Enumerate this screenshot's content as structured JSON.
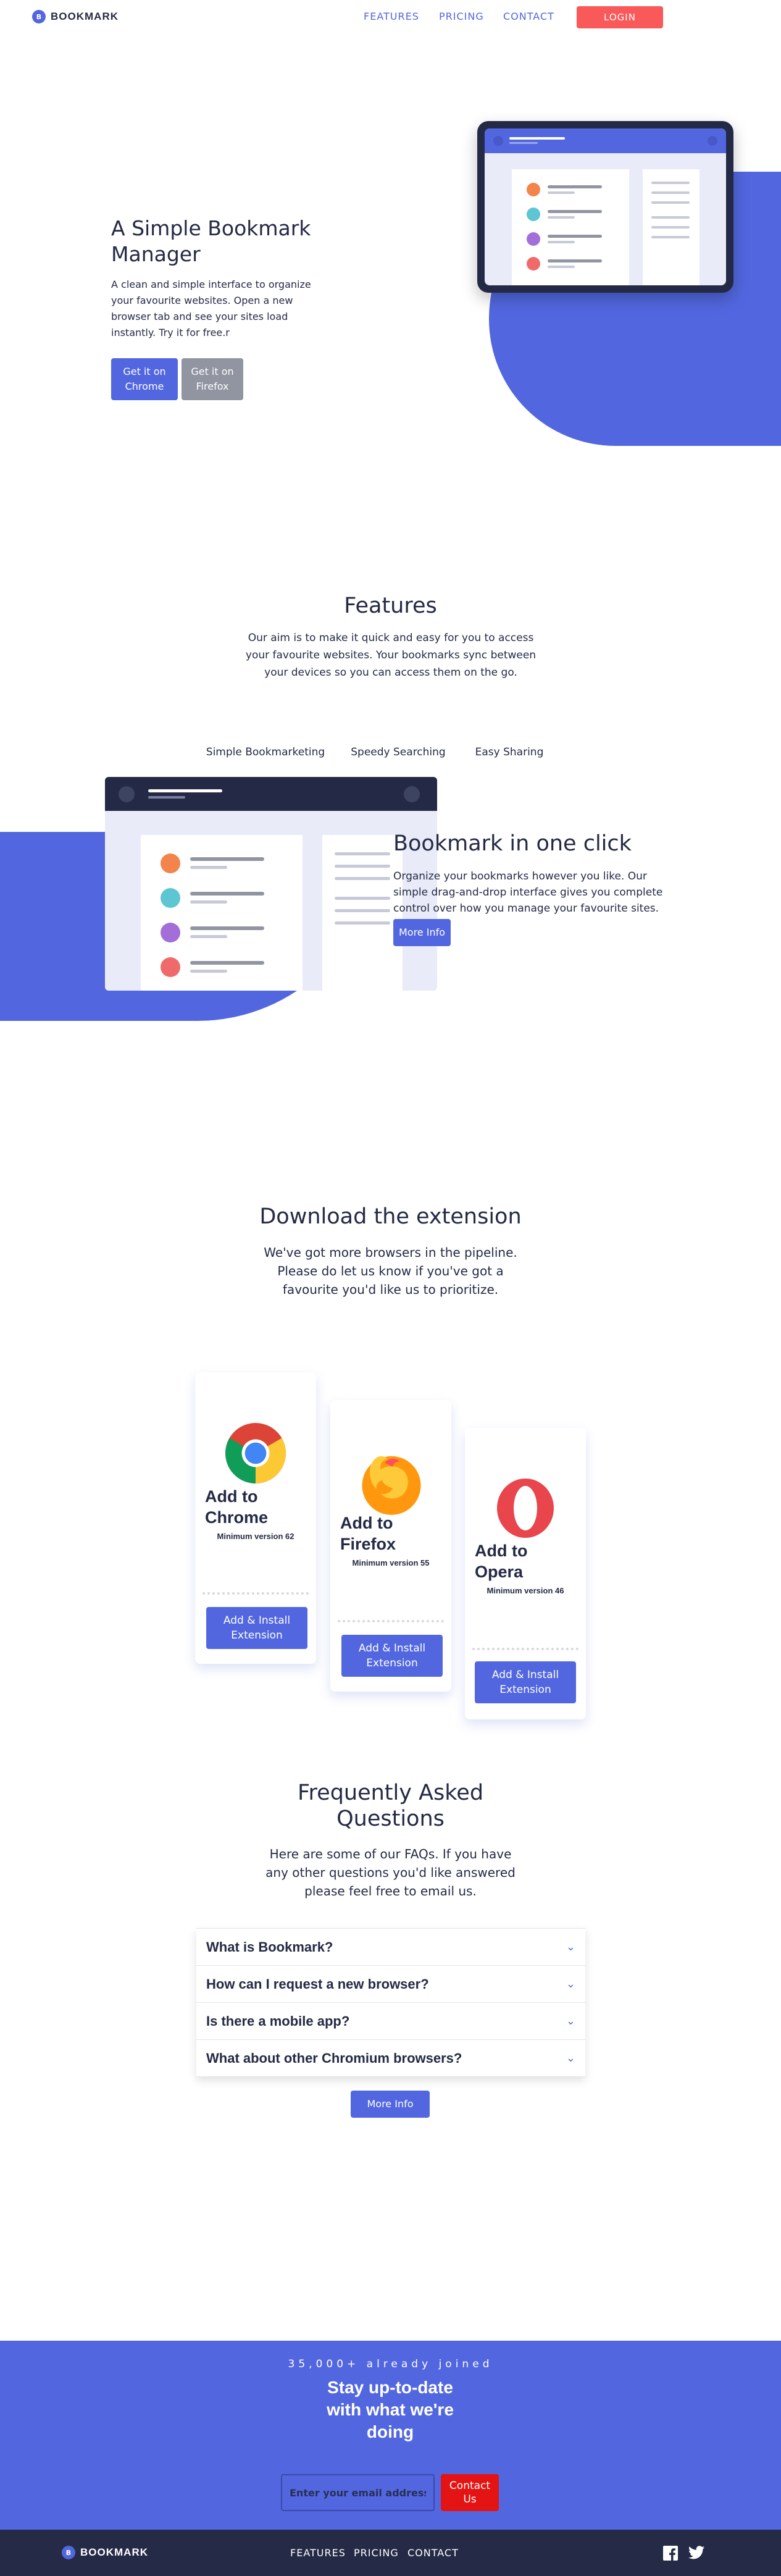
{
  "nav": {
    "logo_mark": "B",
    "brand": "BOOKMARK",
    "links": [
      "FEATURES",
      "PRICING",
      "CONTACT"
    ],
    "login": "LOGIN"
  },
  "hero": {
    "title": "A Simple Bookmark Manager",
    "description": "A clean and simple interface to organize your favourite websites. Open a new browser tab and see your sites load instantly. Try it for free.r",
    "chrome_button": "Get it on Chrome",
    "firefox_button": "Get it on Firefox"
  },
  "features": {
    "title": "Features",
    "description": "Our aim is to make it quick and easy for you to access your favourite websites. Your bookmarks sync between your devices so you can access them on the go.",
    "tabs": [
      "Simple Bookmarketing",
      "Speedy Searching",
      "Easy Sharing"
    ],
    "active_title": "Bookmark in one click",
    "active_description": "Organize your bookmarks however you like. Our simple drag-and-drop interface gives you complete control over how you manage your favourite sites.",
    "more_info": "More Info"
  },
  "download": {
    "title": "Download the extension",
    "description": "We've got more browsers in the pipeline. Please do let us know if you've got a favourite you'd like us to prioritize.",
    "cards": [
      {
        "title": "Add to Chrome",
        "min": "Minimum version 62",
        "button": "Add & Install Extension",
        "icon": "chrome-logo-icon"
      },
      {
        "title": "Add to Firefox",
        "min": "Minimum version 55",
        "button": "Add & Install Extension",
        "icon": "firefox-logo-icon"
      },
      {
        "title": "Add to Opera",
        "min": "Minimum version 46",
        "button": "Add & Install Extension",
        "icon": "opera-logo-icon"
      }
    ]
  },
  "faq": {
    "title": "Frequently Asked Questions",
    "description": "Here are some of our FAQs. If you have any other questions you'd like answered please feel free to email us.",
    "questions": [
      "What is Bookmark?",
      "How can I request a new browser?",
      "Is there a mobile app?",
      "What about other Chromium browsers?"
    ],
    "more_info": "More Info"
  },
  "cta": {
    "kicker": "35,000+ already joined",
    "title": "Stay up-to-date with what we're doing",
    "email_placeholder": "Enter your email addresss",
    "button": "Contact Us"
  },
  "footer": {
    "brand": "BOOKMARK",
    "links": [
      "FEATURES",
      "PRICING",
      "CONTACT"
    ]
  },
  "colors": {
    "primary": "#5267df",
    "accent_red": "#fa5959",
    "dark": "#242a45",
    "grey": "#9194a1",
    "cta_button": "#e41414"
  }
}
